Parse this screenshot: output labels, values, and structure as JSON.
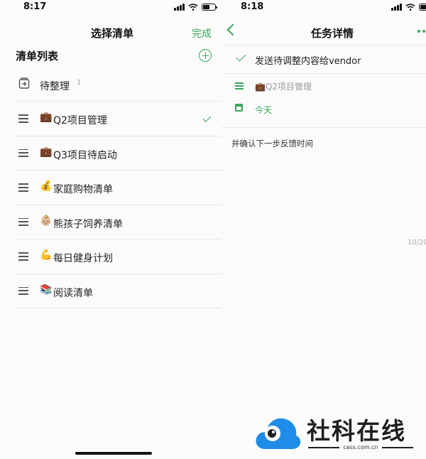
{
  "left_screen": {
    "status_time": "8:17",
    "nav_title": "选择清单",
    "done_label": "完成",
    "section_title": "清单列表",
    "inbox": {
      "label": "待整理",
      "count": "1"
    },
    "lists": [
      {
        "emoji": "💼",
        "label": "Q2项目管理",
        "checked": true
      },
      {
        "emoji": "💼",
        "label": "Q3项目待启动",
        "checked": false
      },
      {
        "emoji": "💰",
        "label": "家庭购物清单",
        "checked": false
      },
      {
        "emoji": "👶🏼",
        "label": "熊孩子饲养清单",
        "checked": false
      },
      {
        "emoji": "💪",
        "label": "每日健身计划",
        "checked": false
      },
      {
        "emoji": "📚",
        "label": "阅读清单",
        "checked": false
      }
    ]
  },
  "right_screen": {
    "status_time": "8:18",
    "nav_title": "任务详情",
    "task_title": "发送待调整内容给vendor",
    "task_list": "💼Q2项目管理",
    "task_date": "今天",
    "task_note": "并确认下一步反馈时间",
    "date_stamp": "10/20"
  },
  "watermark": {
    "text": "社科在线",
    "subtext": "cass.com.cn"
  },
  "colors": {
    "accent": "#3aa55a",
    "text": "#222222",
    "muted": "#999999"
  },
  "icons": [
    "signal-icon",
    "wifi-icon",
    "battery-icon",
    "add-icon",
    "inbox-icon",
    "hamburger-icon",
    "checkmark-icon",
    "back-icon",
    "more-icon",
    "list-icon",
    "calendar-icon"
  ]
}
